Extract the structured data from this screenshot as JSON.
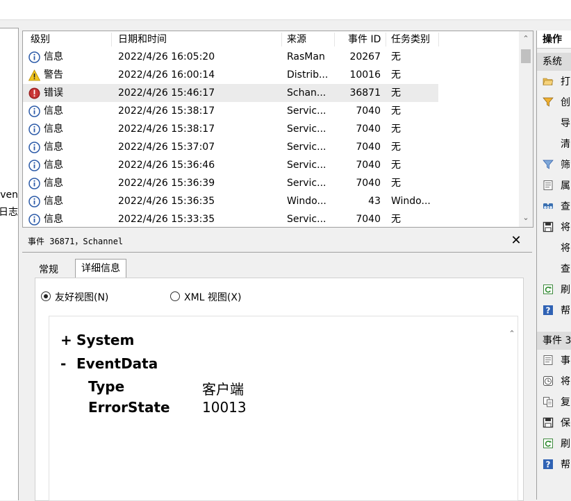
{
  "left_panel": {
    "labels": [
      "ven",
      "日志"
    ]
  },
  "event_list": {
    "columns": [
      "级别",
      "日期和时间",
      "来源",
      "事件 ID",
      "任务类别"
    ],
    "rows": [
      {
        "level_icon": "info-icon",
        "level": "信息",
        "datetime": "2022/4/26 16:05:20",
        "source": "RasMan",
        "event_id": "20267",
        "category": "无"
      },
      {
        "level_icon": "warning-icon",
        "level": "警告",
        "datetime": "2022/4/26 16:00:14",
        "source": "Distrib...",
        "event_id": "10016",
        "category": "无"
      },
      {
        "level_icon": "error-icon",
        "level": "错误",
        "datetime": "2022/4/26 15:46:17",
        "source": "Schan...",
        "event_id": "36871",
        "category": "无",
        "selected": true
      },
      {
        "level_icon": "info-icon",
        "level": "信息",
        "datetime": "2022/4/26 15:38:17",
        "source": "Servic...",
        "event_id": "7040",
        "category": "无"
      },
      {
        "level_icon": "info-icon",
        "level": "信息",
        "datetime": "2022/4/26 15:38:17",
        "source": "Servic...",
        "event_id": "7040",
        "category": "无"
      },
      {
        "level_icon": "info-icon",
        "level": "信息",
        "datetime": "2022/4/26 15:37:07",
        "source": "Servic...",
        "event_id": "7040",
        "category": "无"
      },
      {
        "level_icon": "info-icon",
        "level": "信息",
        "datetime": "2022/4/26 15:36:46",
        "source": "Servic...",
        "event_id": "7040",
        "category": "无"
      },
      {
        "level_icon": "info-icon",
        "level": "信息",
        "datetime": "2022/4/26 15:36:39",
        "source": "Servic...",
        "event_id": "7040",
        "category": "无"
      },
      {
        "level_icon": "info-icon",
        "level": "信息",
        "datetime": "2022/4/26 15:36:35",
        "source": "Windo...",
        "event_id": "43",
        "category": "Windo..."
      },
      {
        "level_icon": "info-icon",
        "level": "信息",
        "datetime": "2022/4/26 15:33:35",
        "source": "Servic...",
        "event_id": "7040",
        "category": "无"
      }
    ]
  },
  "detail": {
    "title": "事件 36871，Schannel",
    "tabs": [
      "常规",
      "详细信息"
    ],
    "active_tab": "详细信息",
    "view_friendly": "友好视图(N)",
    "view_xml": "XML 视图(X)",
    "tree": {
      "system_toggle": "+",
      "system_label": "System",
      "eventdata_toggle": "-",
      "eventdata_label": "EventData",
      "fields": [
        {
          "key": "Type",
          "value": "客户端"
        },
        {
          "key": "ErrorState",
          "value": "10013"
        }
      ]
    }
  },
  "actions": {
    "header": "操作",
    "section1": "系统",
    "section2": "事件 3",
    "items1": [
      {
        "icon": "open-folder-icon",
        "label": "打"
      },
      {
        "icon": "filter-icon",
        "label": "创"
      },
      {
        "icon": "",
        "label": "导"
      },
      {
        "icon": "",
        "label": "清"
      },
      {
        "icon": "filter-outline-icon",
        "label": "筛"
      },
      {
        "icon": "properties-icon",
        "label": "属"
      },
      {
        "icon": "find-icon",
        "label": "查"
      },
      {
        "icon": "save-icon",
        "label": "将"
      },
      {
        "icon": "",
        "label": "将"
      },
      {
        "icon": "",
        "label": "查"
      },
      {
        "icon": "refresh-icon",
        "label": "刷"
      },
      {
        "icon": "help-icon",
        "label": "帮"
      }
    ],
    "items2": [
      {
        "icon": "properties-icon",
        "label": "事"
      },
      {
        "icon": "attach-task-icon",
        "label": "将"
      },
      {
        "icon": "copy-icon",
        "label": "复"
      },
      {
        "icon": "save-icon",
        "label": "保"
      },
      {
        "icon": "refresh-icon",
        "label": "刷"
      },
      {
        "icon": "help-icon",
        "label": "帮"
      }
    ]
  }
}
